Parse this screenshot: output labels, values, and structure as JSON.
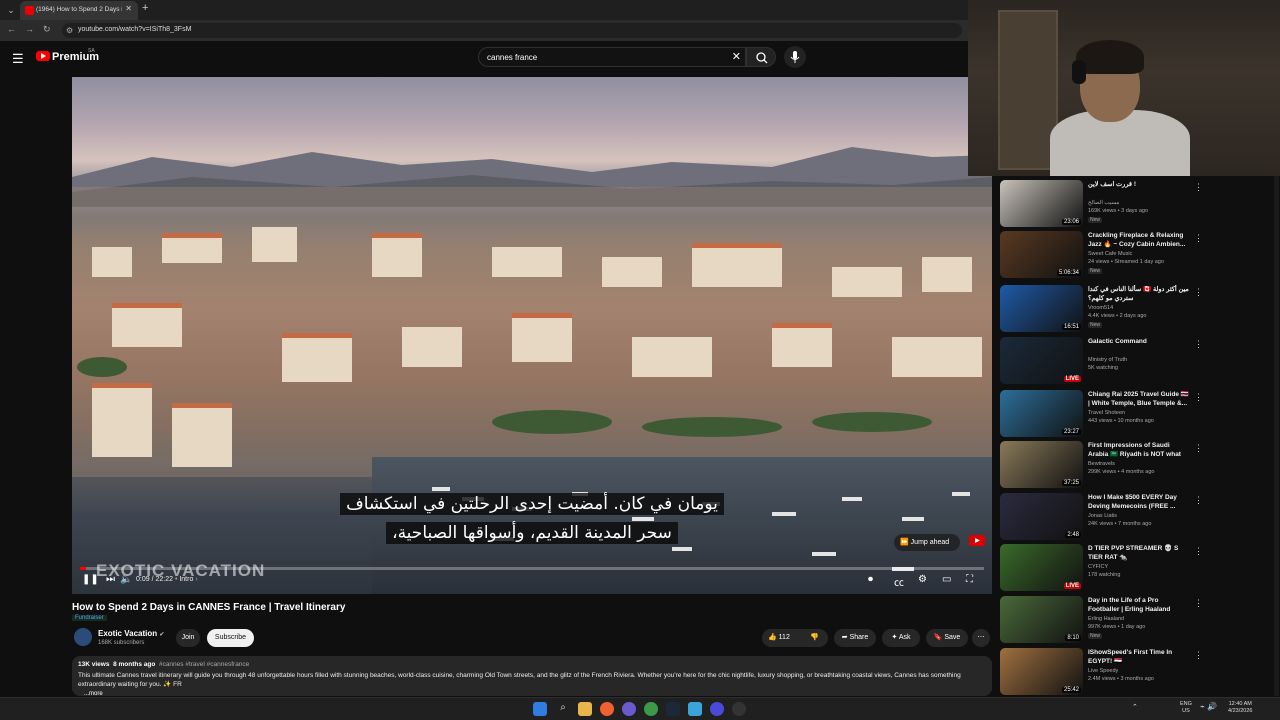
{
  "browser": {
    "tab_title": "(1964) How to Spend 2 Days in",
    "url": "youtube.com/watch?v=ISiTh8_3FsM"
  },
  "header": {
    "logo_text": "Premium",
    "logo_sup": "SA",
    "search_value": "cannes france"
  },
  "video": {
    "subtitle_line1": "يومان في كان.  أمضيت إحدى الرحلتين في استكشاف",
    "subtitle_line2": "سحر المدينة القديم، وأسواقها الصباحية،",
    "watermark": "EXOTIC VACATION",
    "time": "0:09 / 22:22",
    "chapter": "Intro",
    "progress": 0.007,
    "jump_label": "Jump ahead"
  },
  "info": {
    "title": "How to Spend 2 Days in CANNES France | Travel Itinerary",
    "fundraiser": "Fundraiser",
    "channel": "Exotic Vacation",
    "subscribers": "168K subscribers",
    "join": "Join",
    "subscribe": "Subscribe",
    "likes": "112",
    "share": "Share",
    "ask": "Ask",
    "save": "Save",
    "views": "13K views",
    "age": "8 months ago",
    "tags": "#cannes #travel #cannesfrance",
    "description": "This ultimate Cannes travel itinerary will guide you through 48 unforgettable hours filled with stunning beaches, world-class cuisine, charming Old Town streets, and the glitz of the French Riviera. Whether you're here for the chic nightlife, luxury shopping, or breathtaking coastal views, Cannes has something extraordinary waiting for you. ✨ FR",
    "more": "...more"
  },
  "sidebar": [
    {
      "title": "قررت اسف لاين !",
      "channel": "مسيب الصالح",
      "meta": "169K views • 3 days ago",
      "badge": "New",
      "duration": "23:06",
      "color": "#c9c3bb"
    },
    {
      "title": "Crackling Fireplace & Relaxing Jazz 🔥 ~ Cozy Cabin Ambien...",
      "channel": "Sweet Cafe Music",
      "meta": "24 views • Streamed 1 day ago",
      "badge": "New",
      "duration": "5:06:34",
      "color": "#5a3a22"
    },
    {
      "title": "سألنا الناس في كندا 🇨🇦 مين أكثر دولة ستردي مو كلهم؟",
      "channel": "Vroom514",
      "meta": "4.4K views • 2 days ago",
      "badge": "New",
      "duration": "16:51",
      "color": "#1f5aa8"
    },
    {
      "title": "Galactic Command",
      "channel": "Ministry of Truth",
      "meta": "5K watching",
      "badge": "",
      "duration": "LIVE",
      "color": "#1a2a3a"
    },
    {
      "title": "Chiang Rai 2025 Travel Guide 🇹🇭 | White Temple, Blue Temple &...",
      "channel": "Travel Shoteen",
      "meta": "443 views • 10 months ago",
      "badge": "",
      "duration": "23:27",
      "color": "#2c6f9a"
    },
    {
      "title": "First Impressions of Saudi Arabia 🇸🇦 Riyadh is NOT what w...",
      "channel": "Bewtravels",
      "meta": "299K views • 4 months ago",
      "badge": "",
      "duration": "37:25",
      "color": "#8a7a5a"
    },
    {
      "title": "How I Make $500 EVERY Day Deving Memecoins (FREE ...",
      "channel": "Jonas Liatis",
      "meta": "24K views • 7 months ago",
      "badge": "",
      "duration": "2:48",
      "color": "#2b2b40"
    },
    {
      "title": "D TIER PVP STREAMER 💀 S TIER RAT 🐀",
      "channel": "CYFICY",
      "meta": "178 watching",
      "badge": "",
      "duration": "LIVE",
      "color": "#3a6a2a"
    },
    {
      "title": "Day in the Life of a Pro Footballer | Erling Haaland",
      "channel": "Erling Haaland",
      "meta": "997K views • 1 day ago",
      "badge": "New",
      "duration": "8:10",
      "color": "#4a6a3a"
    },
    {
      "title": "IShowSpeed's First Time In EGYPT! 🇪🇬",
      "channel": "Live Speedy",
      "meta": "2.4M views • 3 months ago",
      "badge": "",
      "duration": "25:42",
      "color": "#a07040"
    }
  ],
  "taskbar": {
    "lang_line1": "ENG",
    "lang_line2": "US",
    "clock_time": "12:40 AM",
    "clock_date": "4/23/2026"
  }
}
